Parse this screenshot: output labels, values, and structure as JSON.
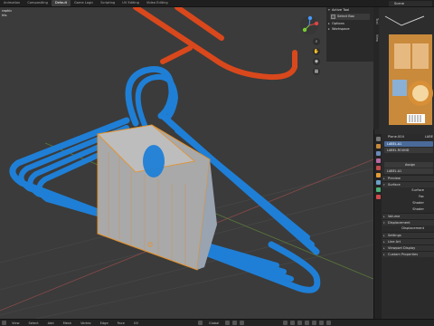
{
  "menu": {
    "items": [
      "Animation",
      "Compositing",
      "Default",
      "Game Logic",
      "Scripting",
      "UV Editing",
      "Video Editing"
    ],
    "active_index": 2
  },
  "scene": {
    "label": "Scene"
  },
  "viewport": {
    "header_lines": [
      "raphic",
      "hts"
    ],
    "tool_panel": {
      "active_tool_label": "Active Tool",
      "select_box_label": "Select Box",
      "options_label": "Options",
      "workspace_label": "Workspace"
    },
    "side_tabs": [
      "Tool",
      "View"
    ]
  },
  "right_strip": {
    "tabs": [
      "Tool",
      "View"
    ]
  },
  "properties": {
    "object_name": "Plane.004",
    "object_suffix": "LABE",
    "material_slots": [
      "LABEL.A1",
      "LABEL.ROUND"
    ],
    "assign_label": "Assign",
    "material_name": "LABEL.A1",
    "sections": {
      "preview": "Preview",
      "surface": "Surface",
      "surface_value": "Surface",
      "fac_label": "Fac",
      "shader1": "Shader",
      "shader2": "Shader",
      "volume": "Volume",
      "displacement": "Displacement",
      "displacement_value": "Displacement",
      "settings": "Settings",
      "line_art": "Line Art",
      "viewport_display": "Viewport Display",
      "custom_properties": "Custom Properties"
    }
  },
  "statusbar": {
    "left": [
      "View",
      "Select",
      "Add",
      "Mesh",
      "Vertex",
      "Edge",
      "Face",
      "UV"
    ],
    "transform": "Global"
  },
  "colors": {
    "hanger_blue": "#1f7fd6",
    "hanger_orange": "#d9481c",
    "label_grey": "#b7b7b7",
    "selection_orange": "#e89024",
    "viewport_bg": "#3b3b3b"
  }
}
